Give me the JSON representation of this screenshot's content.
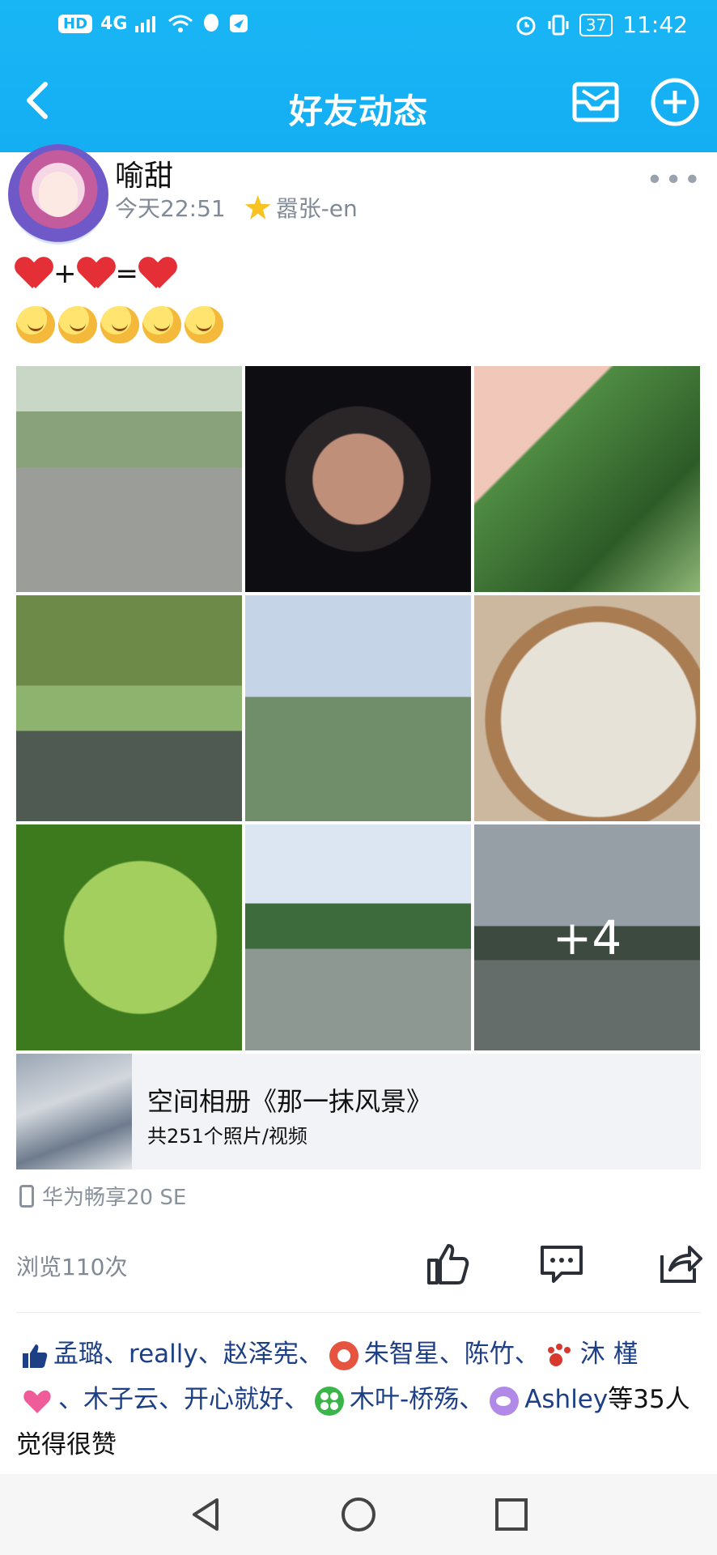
{
  "status": {
    "left_badge": "HD",
    "network": "4G",
    "battery": "37",
    "time": "11:42"
  },
  "header": {
    "title": "好友动态",
    "back_icon": "chevron-left-icon",
    "mail_icon": "inbox-icon",
    "add_icon": "plus-circle-icon"
  },
  "post": {
    "author": "喻甜",
    "time": "今天22:51",
    "tag": "嚣张-en",
    "more": "•••",
    "line1": [
      "+",
      "="
    ],
    "emoji_count": 5,
    "photos": [
      {
        "label": "bridge-umbrella-photo"
      },
      {
        "label": "night-selfie-photo"
      },
      {
        "label": "clover-hand-photo"
      },
      {
        "label": "stream-rocks-photo"
      },
      {
        "label": "heart-hands-photo"
      },
      {
        "label": "mirror-selfie-photo"
      },
      {
        "label": "four-leaf-clover-photo"
      },
      {
        "label": "river-landscape-photo"
      },
      {
        "label": "umbrella-rail-photo",
        "overlay": "+4"
      }
    ],
    "album": {
      "title": "空间相册《那一抹风景》",
      "count": "共251个照片/视频"
    },
    "device": "华为畅享20 SE",
    "views": "浏览110次",
    "likes": {
      "names1": "孟璐、really、赵泽宪、",
      "names2": "朱智星、陈竹、",
      "names3": "沐 槿",
      "names4": "、木子云、开心就好、",
      "names5": "木叶-桥殇、",
      "names6": "Ashley",
      "suffix": "等35人觉得很赞"
    }
  },
  "colors": {
    "accent": "#16b0f3",
    "link": "#1c3f86",
    "gray": "#808a96"
  }
}
